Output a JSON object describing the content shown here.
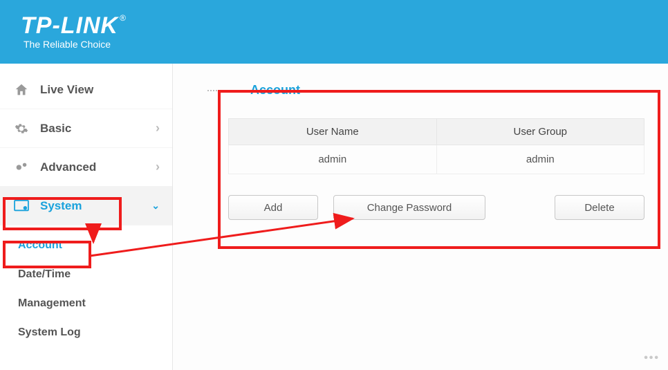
{
  "brand": {
    "name": "TP-LINK",
    "tagline": "The Reliable Choice"
  },
  "nav": {
    "live_view": "Live View",
    "basic": "Basic",
    "advanced": "Advanced",
    "system": "System",
    "sub": {
      "account": "Account",
      "datetime": "Date/Time",
      "management": "Management",
      "syslog": "System Log"
    }
  },
  "panel": {
    "title": "Account",
    "columns": {
      "user_name": "User Name",
      "user_group": "User Group"
    },
    "rows": [
      {
        "user_name": "admin",
        "user_group": "admin"
      }
    ],
    "buttons": {
      "add": "Add",
      "change_password": "Change Password",
      "delete_": "Delete"
    }
  },
  "colors": {
    "brand": "#2aa7dc",
    "accent": "#1aa2dc",
    "annotation": "#ef1c1c"
  }
}
